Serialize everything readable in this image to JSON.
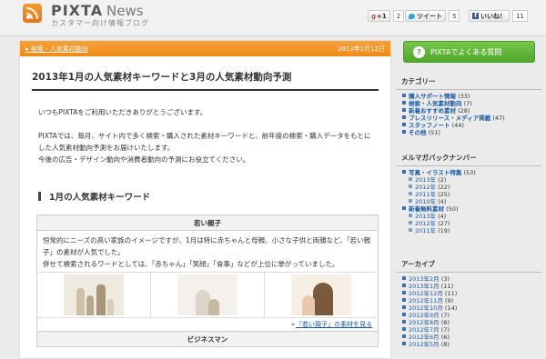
{
  "header": {
    "logo_text": "PIXTA",
    "logo_news": "News",
    "logo_subtitle": "カスタマー向け情報ブログ",
    "gplus_label": "+1",
    "gplus_count": "2",
    "tweet_label": "ツイート",
    "tweet_count": "5",
    "like_label": "いいね！",
    "like_count": "11"
  },
  "post": {
    "category": "検索・人気素材動向",
    "date": "2013年2月12日",
    "title": "2013年1月の人気素材キーワードと3月の人気素材動向予測",
    "intro": "いつもPIXTAをご利用いただきありがとうございます。",
    "body_1": "PIXTAでは、毎月、サイト内で多く検索・購入された素材キーワードと、前年度の検索・購入データをもとにした人気素材動向予測をお届けいたします。",
    "body_2": "今後の広告・デザイン動向や消費者動向の予測にお役立てください。",
    "section_title": "1月の人気素材キーワード",
    "keyword_1": {
      "heading": "若い親子",
      "text_1": "恒常的にニーズの高い家族のイメージですが、1月は特に赤ちゃんと母親、小さな子供と両親など、「若い親子」の素材が人気でした。",
      "text_2": "併せて検索されるワードとしては、「赤ちゃん」「笑顔」「食事」などが上位に挙がっていました。",
      "link": "「若い親子」の素材を見る"
    },
    "keyword_2": {
      "heading": "ビジネスマン"
    }
  },
  "sidebar": {
    "faq_label": "PIXTAでよくある質問",
    "categories_title": "カテゴリー",
    "categories": [
      {
        "label": "購入サポート情報",
        "count": "(33)"
      },
      {
        "label": "検索・人気素材動向",
        "count": "(7)"
      },
      {
        "label": "新着おすすめ素材",
        "count": "(28)"
      },
      {
        "label": "プレスリリース・メディア掲載",
        "count": "(47)"
      },
      {
        "label": "スタッフノート",
        "count": "(44)"
      },
      {
        "label": "その他",
        "count": "(51)"
      }
    ],
    "backnumber_title": "メルマガバックナンバー",
    "backnumber": [
      {
        "label": "写真・イラスト特集",
        "count": "(53)",
        "sub": false
      },
      {
        "label": "2013年",
        "count": "(2)",
        "sub": true
      },
      {
        "label": "2012年",
        "count": "(22)",
        "sub": true
      },
      {
        "label": "2011年",
        "count": "(25)",
        "sub": true
      },
      {
        "label": "2010年",
        "count": "(4)",
        "sub": true
      },
      {
        "label": "新着無料素材",
        "count": "(50)",
        "sub": false
      },
      {
        "label": "2013年",
        "count": "(4)",
        "sub": true
      },
      {
        "label": "2012年",
        "count": "(27)",
        "sub": true
      },
      {
        "label": "2011年",
        "count": "(19)",
        "sub": true
      }
    ],
    "archive_title": "アーカイブ",
    "archive": [
      {
        "label": "2013年2月",
        "count": "(3)"
      },
      {
        "label": "2013年1月",
        "count": "(11)"
      },
      {
        "label": "2012年12月",
        "count": "(11)"
      },
      {
        "label": "2012年11月",
        "count": "(9)"
      },
      {
        "label": "2012年10月",
        "count": "(14)"
      },
      {
        "label": "2012年9月",
        "count": "(7)"
      },
      {
        "label": "2012年8月",
        "count": "(8)"
      },
      {
        "label": "2012年7月",
        "count": "(7)"
      },
      {
        "label": "2012年6月",
        "count": "(6)"
      },
      {
        "label": "2012年5月",
        "count": "(8)"
      }
    ]
  }
}
